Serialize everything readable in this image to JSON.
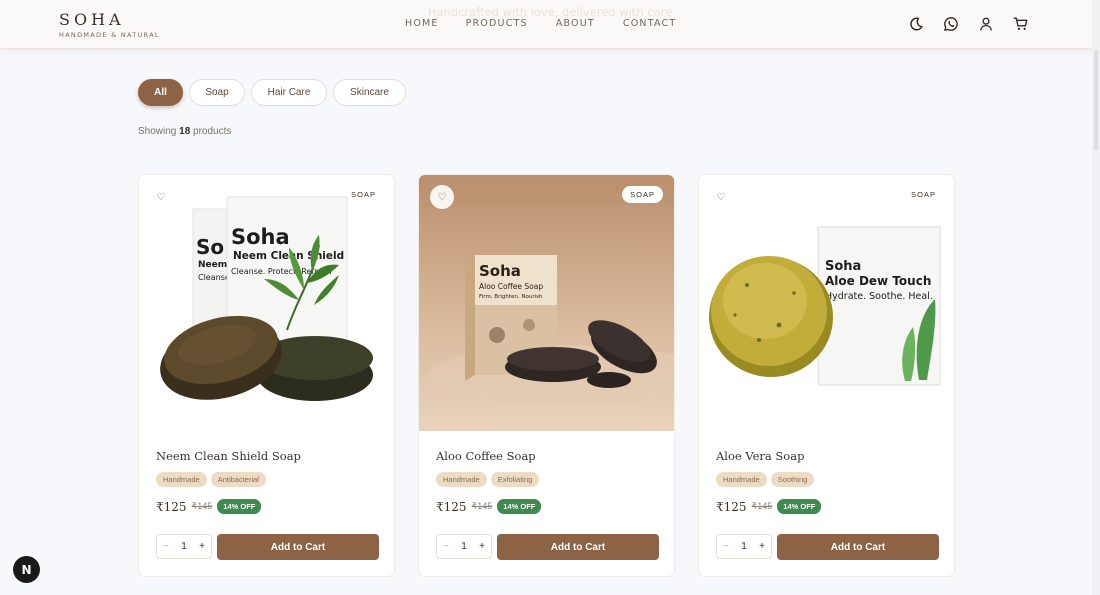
{
  "header": {
    "brand_name": "SOHA",
    "brand_tagline": "HANDMADE & NATURAL",
    "banner_text": "Handcrafted with love, delivered with care",
    "nav": [
      "HOME",
      "PRODUCTS",
      "ABOUT",
      "CONTACT"
    ],
    "icons": [
      "moon-icon",
      "whatsapp-icon",
      "user-icon",
      "cart-icon"
    ]
  },
  "filters": {
    "chips": [
      "All",
      "Soap",
      "Hair Care",
      "Skincare"
    ],
    "active": "All"
  },
  "results": {
    "prefix": "Showing",
    "count": "18",
    "suffix": "products"
  },
  "products": [
    {
      "name": "Neem Clean Shield Soap",
      "category": "SOAP",
      "tags": [
        "Handmade",
        "Antibacterial"
      ],
      "price": "₹125",
      "original_price": "₹145",
      "discount": "14% OFF",
      "quantity": "1",
      "cta": "Add to Cart",
      "box_brand": "Soha",
      "box_product": "Neem Clean Shield",
      "box_tagline": "Cleanse. Protect. Refresh",
      "back_box_brand": "So",
      "back_box_line1": "Neem",
      "back_box_line2": "Cleanse"
    },
    {
      "name": "Aloo Coffee Soap",
      "category": "SOAP",
      "tags": [
        "Handmade",
        "Exfoliating"
      ],
      "price": "₹125",
      "original_price": "₹145",
      "discount": "14% OFF",
      "quantity": "1",
      "cta": "Add to Cart",
      "box_brand": "Soha",
      "box_product": "Aloo Coffee Soap",
      "box_tagline": "Firm. Brighten. Nourish"
    },
    {
      "name": "Aloe Vera Soap",
      "category": "SOAP",
      "tags": [
        "Handmade",
        "Soothing"
      ],
      "price": "₹125",
      "original_price": "₹145",
      "discount": "14% OFF",
      "quantity": "1",
      "cta": "Add to Cart",
      "box_brand": "Soha",
      "box_product": "Aloe Dew Touch",
      "box_tagline": "Hydrate. Soothe. Heal."
    }
  ],
  "glyphs": {
    "heart": "♡",
    "minus": "−",
    "plus": "+"
  },
  "dev_badge": "N",
  "colors": {
    "accent": "#8d6346",
    "tag_bg": "#ecdcc4",
    "discount": "#3f8a4f"
  }
}
